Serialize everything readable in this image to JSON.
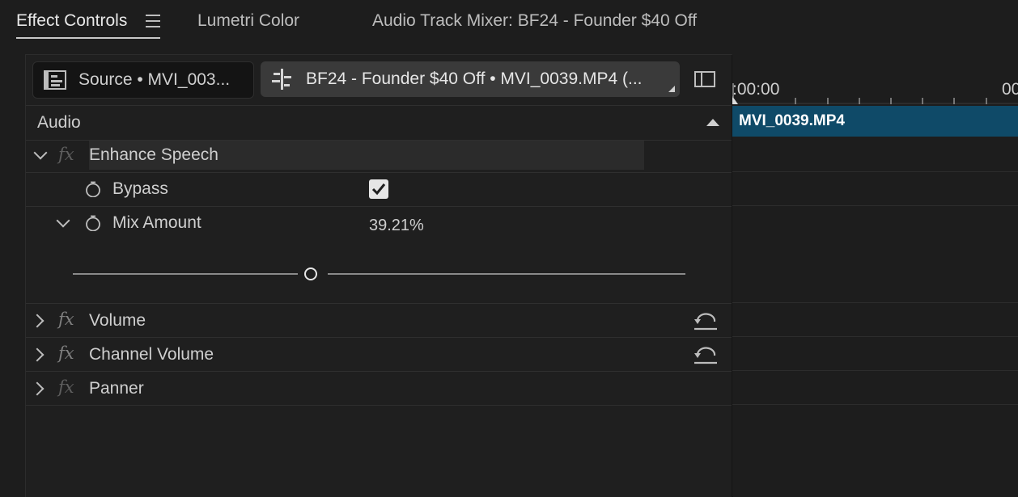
{
  "tabs": [
    {
      "label": "Effect Controls",
      "active": true
    },
    {
      "label": "Lumetri Color",
      "active": false
    },
    {
      "label": "Audio Track Mixer: BF24 - Founder $40 Off",
      "active": false
    }
  ],
  "selectors": {
    "source": "Source • MVI_003...",
    "sequence": "BF24 - Founder $40 Off • MVI_0039.MP4 (..."
  },
  "section": {
    "title": "Audio"
  },
  "effects": [
    {
      "name": "Enhance Speech",
      "expanded": true,
      "params": [
        {
          "name": "Bypass",
          "checked": true
        },
        {
          "name": "Mix Amount",
          "value": "39.21%",
          "slider_fraction": 0.39
        }
      ]
    },
    {
      "name": "Volume",
      "expanded": false
    },
    {
      "name": "Channel Volume",
      "expanded": false
    },
    {
      "name": "Panner",
      "expanded": false
    }
  ],
  "timeline": {
    "start_time": ":00:00",
    "end_time_partial": "00",
    "clip_name": "MVI_0039.MP4"
  },
  "colors": {
    "accent_clip": "#0f4a68",
    "background": "#1d1d1d"
  }
}
